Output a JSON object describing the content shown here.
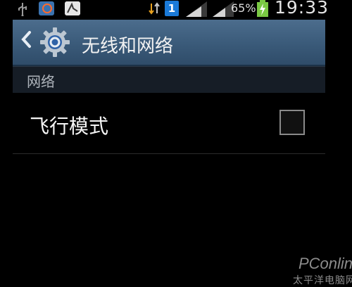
{
  "status_bar": {
    "battery_percent": "65%",
    "time": "19:33",
    "sim_badge": "1",
    "icons": [
      "usb-icon",
      "notification-app-icon",
      "notification-app-icon",
      "sync-icon",
      "sim-icon",
      "signal-icon",
      "signal-icon",
      "battery-charging-icon"
    ]
  },
  "header": {
    "title": "无线和网络",
    "back_icon": "chevron-left-icon",
    "settings_icon": "gear-icon"
  },
  "section": {
    "title": "网络"
  },
  "items": [
    {
      "label": "飞行模式",
      "checked": false
    }
  ],
  "watermark": {
    "logo": "PConline",
    "subtitle": "太平洋电脑网"
  },
  "colors": {
    "header": "#3f6080",
    "section": "#161d26",
    "background": "#000000",
    "accent": "#1a7ad8"
  }
}
